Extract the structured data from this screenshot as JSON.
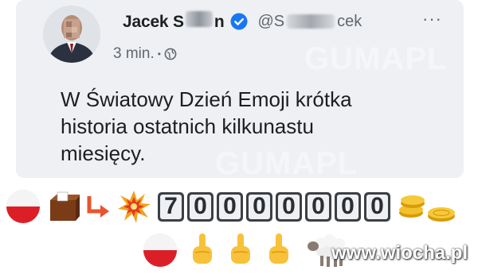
{
  "author": {
    "name_prefix": "Jacek S",
    "name_suffix": "n",
    "handle_prefix": "@S",
    "handle_suffix": "cek",
    "more_label": "···"
  },
  "meta": {
    "time": "3 min.",
    "separator": "•"
  },
  "post": {
    "line1": "W Światowy Dzień Emoji krótka",
    "line2": "historia ostatnich kilkunastu",
    "line3": "miesięcy."
  },
  "counter_digits": [
    "7",
    "0",
    "0",
    "0",
    "0",
    "0",
    "0",
    "0"
  ],
  "watermarks": {
    "overlay": "GUMAPL",
    "site": "www.wiocha.pl"
  },
  "icons": {
    "row1": [
      "poland-flag-icon",
      "ballot-box-icon",
      "arrow-down-right-icon",
      "explosion-icon",
      "number-keycaps",
      "coins-icon"
    ],
    "row2": [
      "poland-flag-icon",
      "middle-finger-icon",
      "middle-finger-icon",
      "middle-finger-icon",
      "sheep-icon"
    ]
  },
  "colors": {
    "flag_white": "#f4f4f4",
    "flag_red": "#dc1f26",
    "verified_blue": "#1877f2",
    "text_primary": "#1c1e21",
    "text_secondary": "#606770"
  }
}
